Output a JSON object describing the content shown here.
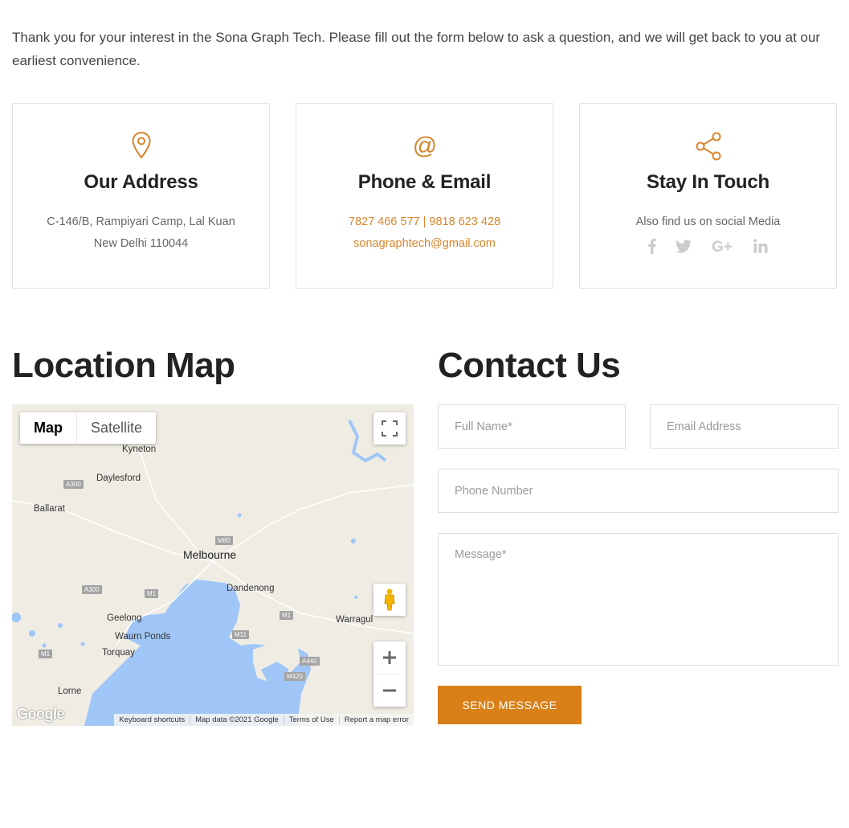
{
  "intro": "Thank you for your interest in the Sona Graph Tech. Please fill out the form below to ask a question, and we will get back to you at our earliest convenience.",
  "cards": {
    "address": {
      "icon": "location-pin-icon",
      "title": "Our Address",
      "line1": "C-146/B, Rampiyari Camp, Lal Kuan",
      "line2": "New Delhi 110044"
    },
    "contact": {
      "icon": "at-sign-icon",
      "title": "Phone & Email",
      "phones": "7827 466 577 | 9818 623 428",
      "email": "sonagraphtech@gmail.com"
    },
    "social": {
      "icon": "share-icon",
      "title": "Stay In Touch",
      "text": "Also find us on social Media",
      "links": [
        "facebook-icon",
        "twitter-icon",
        "google-plus-icon",
        "linkedin-icon"
      ]
    }
  },
  "location": {
    "heading": "Location Map",
    "map": {
      "type_map": "Map",
      "type_satellite": "Satellite",
      "places": {
        "kyneton": "Kyneton",
        "daylesford": "Daylesford",
        "ballarat": "Ballarat",
        "melbourne": "Melbourne",
        "dandenong": "Dandenong",
        "geelong": "Geelong",
        "waurn_ponds": "Waurn Ponds",
        "torquay": "Torquay",
        "warragul": "Warragul",
        "lorne": "Lorne"
      },
      "roads": {
        "a300_1": "A300",
        "m80": "M80",
        "a300_2": "A300",
        "m1_1": "M1",
        "m1_2": "M1",
        "m11": "M11",
        "m1_3": "M1",
        "a440": "A440",
        "m420": "M420"
      },
      "logo": "Google",
      "attribution": {
        "shortcuts": "Keyboard shortcuts",
        "data": "Map data ©2021 Google",
        "terms": "Terms of Use",
        "report": "Report a map error"
      }
    }
  },
  "contact_form": {
    "heading": "Contact Us",
    "full_name_placeholder": "Full Name*",
    "email_placeholder": "Email Address",
    "phone_placeholder": "Phone Number",
    "message_placeholder": "Message*",
    "submit": "SEND MESSAGE"
  },
  "colors": {
    "accent": "#d98018",
    "heading": "#222222",
    "water": "#9fc6f7",
    "land": "#efece4"
  }
}
